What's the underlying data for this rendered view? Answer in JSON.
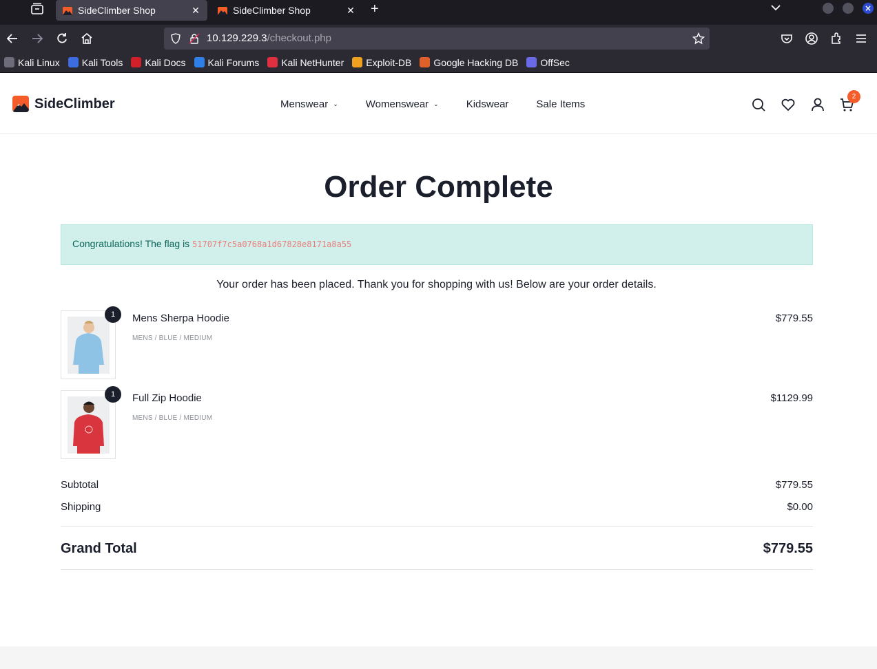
{
  "browser": {
    "tabs": [
      {
        "title": "SideClimber Shop",
        "active": true
      },
      {
        "title": "SideClimber Shop",
        "active": false
      }
    ],
    "url_host": "10.129.229.3",
    "url_path": "/checkout.php",
    "bookmarks": [
      {
        "label": "Kali Linux",
        "icon": "kali-dragon-icon",
        "color": "#6c6c7a"
      },
      {
        "label": "Kali Tools",
        "icon": "kali-tools-icon",
        "color": "#3d6be0"
      },
      {
        "label": "Kali Docs",
        "icon": "kali-docs-icon",
        "color": "#d0202a"
      },
      {
        "label": "Kali Forums",
        "icon": "kali-forums-icon",
        "color": "#2f7fe8"
      },
      {
        "label": "Kali NetHunter",
        "icon": "nethunter-icon",
        "color": "#e03040"
      },
      {
        "label": "Exploit-DB",
        "icon": "exploit-db-icon",
        "color": "#f0a020"
      },
      {
        "label": "Google Hacking DB",
        "icon": "ghdb-icon",
        "color": "#e0602a"
      },
      {
        "label": "OffSec",
        "icon": "offsec-icon",
        "color": "#6a6ae8"
      }
    ]
  },
  "site": {
    "brand": "SideClimber",
    "brand_color": "#f45d2a",
    "menu": [
      {
        "label": "Menswear",
        "dropdown": true
      },
      {
        "label": "Womenswear",
        "dropdown": true
      },
      {
        "label": "Kidswear",
        "dropdown": false
      },
      {
        "label": "Sale Items",
        "dropdown": false
      }
    ],
    "cart_count": "2"
  },
  "order": {
    "title": "Order Complete",
    "alert_text": "Congratulations! The flag is ",
    "flag": "51707f7c5a0768a1d67828e8171a8a55",
    "thanks": "Your order has been placed. Thank you for shopping with us! Below are your order details.",
    "items": [
      {
        "qty": "1",
        "name": "Mens Sherpa Hoodie",
        "variant": "MENS / BLUE / MEDIUM",
        "price": "$779.55",
        "shirt_color": "#8ec3e6"
      },
      {
        "qty": "1",
        "name": "Full Zip Hoodie",
        "variant": "MENS / BLUE / MEDIUM",
        "price": "$1129.99",
        "shirt_color": "#d9353f"
      }
    ],
    "subtotal_label": "Subtotal",
    "subtotal": "$779.55",
    "shipping_label": "Shipping",
    "shipping": "$0.00",
    "grand_total_label": "Grand Total",
    "grand_total": "$779.55"
  }
}
